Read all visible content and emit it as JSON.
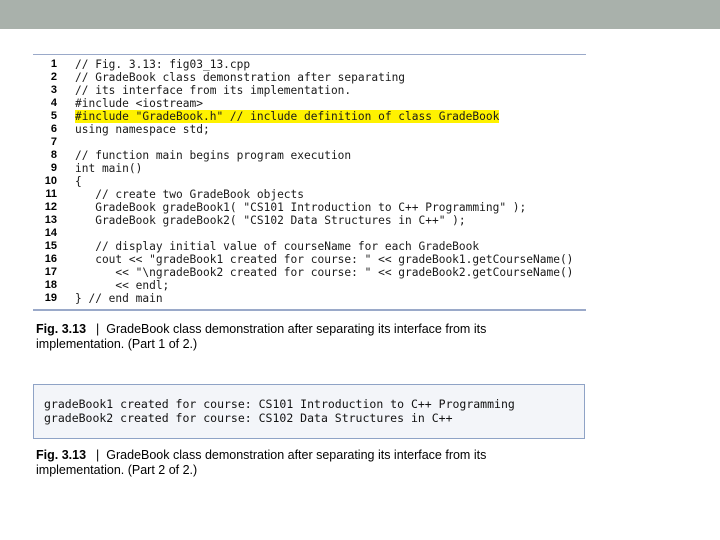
{
  "code_lines": [
    {
      "n": "1",
      "text": "// Fig. 3.13: fig03_13.cpp"
    },
    {
      "n": "2",
      "text": "// GradeBook class demonstration after separating"
    },
    {
      "n": "3",
      "text": "// its interface from its implementation."
    },
    {
      "n": "4",
      "text": "#include <iostream>"
    },
    {
      "n": "5",
      "text": "#include \"GradeBook.h\" // include definition of class GradeBook"
    },
    {
      "n": "6",
      "text": "using namespace std;"
    },
    {
      "n": "7",
      "text": ""
    },
    {
      "n": "8",
      "text": "// function main begins program execution"
    },
    {
      "n": "9",
      "text": "int main()"
    },
    {
      "n": "10",
      "text": "{"
    },
    {
      "n": "11",
      "text": "   // create two GradeBook objects"
    },
    {
      "n": "12",
      "text": "   GradeBook gradeBook1( \"CS101 Introduction to C++ Programming\" );"
    },
    {
      "n": "13",
      "text": "   GradeBook gradeBook2( \"CS102 Data Structures in C++\" );"
    },
    {
      "n": "14",
      "text": ""
    },
    {
      "n": "15",
      "text": "   // display initial value of courseName for each GradeBook"
    },
    {
      "n": "16",
      "text": "   cout << \"gradeBook1 created for course: \" << gradeBook1.getCourseName()"
    },
    {
      "n": "17",
      "text": "      << \"\\ngradeBook2 created for course: \" << gradeBook2.getCourseName()"
    },
    {
      "n": "18",
      "text": "      << endl;"
    },
    {
      "n": "19",
      "text": "} // end main"
    }
  ],
  "caption1": {
    "label": "Fig. 3.13",
    "sep": "|",
    "text": "GradeBook class demonstration after separating its interface from its implementation. (Part 1 of 2.)"
  },
  "output_lines": [
    "gradeBook1 created for course: CS101 Introduction to C++ Programming",
    "gradeBook2 created for course: CS102 Data Structures in C++"
  ],
  "caption2": {
    "label": "Fig. 3.13",
    "sep": "|",
    "text": "GradeBook class demonstration after separating its interface from its implementation. (Part 2 of 2.)"
  }
}
